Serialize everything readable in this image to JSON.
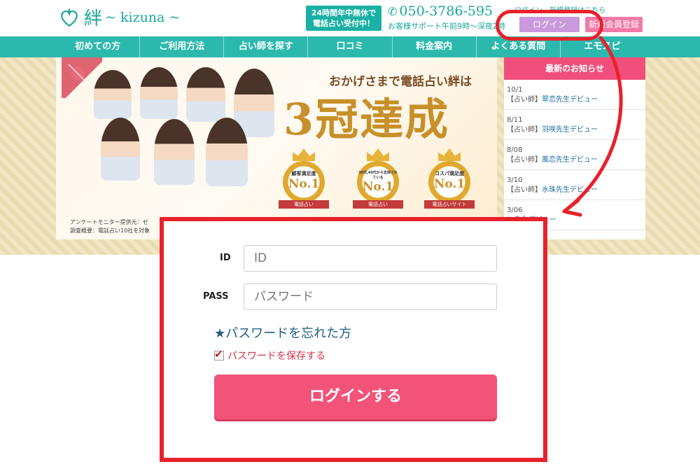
{
  "header": {
    "logo_kanji": "絆",
    "logo_roman": "~ kizuna ~",
    "hours_line1": "24時間年中無休で",
    "hours_line2": "電話占い受付中！",
    "phone": "050-3786-595",
    "support": "お客様サポート午前9時〜深夜2時",
    "top_links": "ログイン　新規登録はこちら",
    "login_button": "ログイン",
    "register_button": "新規会員登録"
  },
  "nav": {
    "items": [
      "初めての方",
      "ご利用方法",
      "占い師を探す",
      "口コミ",
      "料金案内",
      "よくある質問",
      "エモスピ"
    ]
  },
  "banner": {
    "catch_line": "おかげさまで電話占い絆は",
    "catch_big": "3冠達成",
    "awards": [
      {
        "top": "顧客満足度",
        "rank": "No.1",
        "tag": "電話占い"
      },
      {
        "top": "30代,40代から支持されている",
        "rank": "No.1",
        "tag": "電話占い"
      },
      {
        "top": "コスパ満足度",
        "rank": "No.1",
        "tag": "電話占いサイト"
      }
    ],
    "note1": "アンケートモニター提供元：ゼ",
    "note2": "調査概要：電話占い10社を対象"
  },
  "news": {
    "header": "最新のお知らせ",
    "items": [
      {
        "date": "10/1",
        "category": "【占い師】",
        "title": "翠恋先生デビュー"
      },
      {
        "date": "8/11",
        "category": "【占い師】",
        "title": "羽咲先生デビュー"
      },
      {
        "date": "8/08",
        "category": "【占い師】",
        "title": "風恋先生デビュー"
      },
      {
        "date": "3/10",
        "category": "【占い師】",
        "title": "水珠先生デビュー"
      },
      {
        "date": "3/06",
        "category": "",
        "title": "liz先生デビュー"
      }
    ]
  },
  "login": {
    "id_label": "ID",
    "id_placeholder": "ID",
    "pass_label": "PASS",
    "pass_placeholder": "パスワード",
    "forgot": "★パスワードを忘れた方",
    "remember": "パスワードを保存する",
    "submit": "ログインする"
  },
  "colors": {
    "teal": "#2cb9ad",
    "pink": "#f25379",
    "annotation_red": "#e8212b",
    "purple": "#c999db"
  }
}
